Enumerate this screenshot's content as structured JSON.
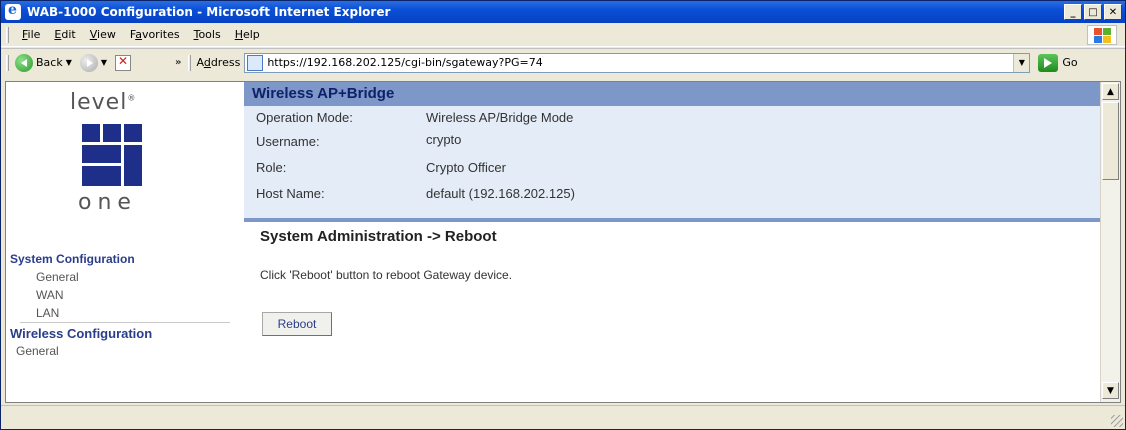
{
  "window": {
    "title": "WAB-1000 Configuration - Microsoft Internet Explorer",
    "controls": [
      "_",
      "□",
      "✕"
    ]
  },
  "menubar": {
    "items": [
      {
        "u": "F",
        "rest": "ile"
      },
      {
        "u": "E",
        "rest": "dit"
      },
      {
        "u": "V",
        "rest": "iew"
      },
      {
        "pre": "F",
        "u": "a",
        "rest": "vorites"
      },
      {
        "u": "T",
        "rest": "ools"
      },
      {
        "u": "H",
        "rest": "elp"
      }
    ]
  },
  "toolbar": {
    "back_label": "Back",
    "more": "»",
    "address_label_pre": "A",
    "address_label_u": "d",
    "address_label_rest": "dress",
    "url": "https://192.168.202.125/cgi-bin/sgateway?PG=74",
    "go_label": "Go"
  },
  "logo": {
    "top": "level",
    "reg": "®",
    "bottom": "one"
  },
  "leftnav": {
    "sections": [
      {
        "heading": "System Configuration",
        "items": [
          "General",
          "WAN",
          "LAN"
        ]
      },
      {
        "heading": "Wireless Configuration",
        "items": [
          "General"
        ]
      }
    ]
  },
  "main": {
    "banner": "Wireless AP+Bridge",
    "info": [
      {
        "label": "Operation Mode:",
        "value": "Wireless AP/Bridge Mode"
      },
      {
        "label": "Username:",
        "value": "crypto"
      },
      {
        "label": "Role:",
        "value": "Crypto Officer"
      },
      {
        "label": "Host Name:",
        "value": "default (192.168.202.125)"
      }
    ],
    "section_title": "System Administration -> Reboot",
    "message": "Click 'Reboot' button to reboot Gateway device.",
    "reboot_button": "Reboot"
  },
  "colors": {
    "banner": "#7d98c8",
    "info_bg": "#e4ecf7",
    "nav_heading": "#2a3d8a"
  }
}
